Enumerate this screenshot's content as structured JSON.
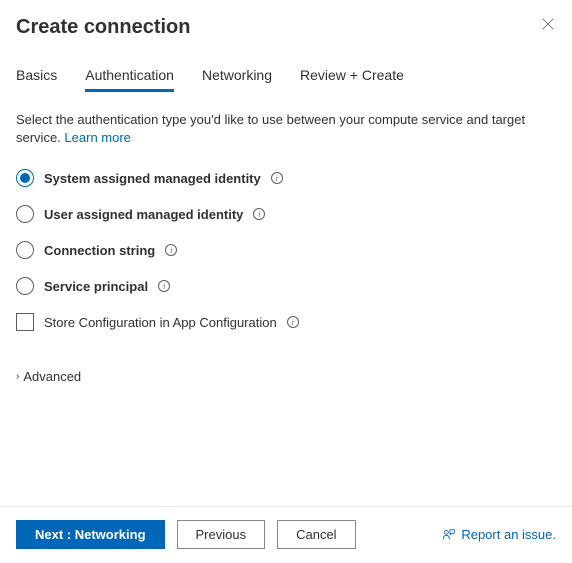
{
  "header": {
    "title": "Create connection"
  },
  "tabs": [
    {
      "label": "Basics",
      "active": false
    },
    {
      "label": "Authentication",
      "active": true
    },
    {
      "label": "Networking",
      "active": false
    },
    {
      "label": "Review + Create",
      "active": false
    }
  ],
  "description": {
    "text": "Select the authentication type you'd like to use between your compute service and target service.",
    "link": "Learn more"
  },
  "auth_options": [
    {
      "label": "System assigned managed identity",
      "checked": true
    },
    {
      "label": "User assigned managed identity",
      "checked": false
    },
    {
      "label": "Connection string",
      "checked": false
    },
    {
      "label": "Service principal",
      "checked": false
    }
  ],
  "store_config": {
    "label": "Store Configuration in App Configuration",
    "checked": false
  },
  "advanced": {
    "label": "Advanced"
  },
  "footer": {
    "next": "Next : Networking",
    "previous": "Previous",
    "cancel": "Cancel",
    "report": "Report an issue."
  }
}
